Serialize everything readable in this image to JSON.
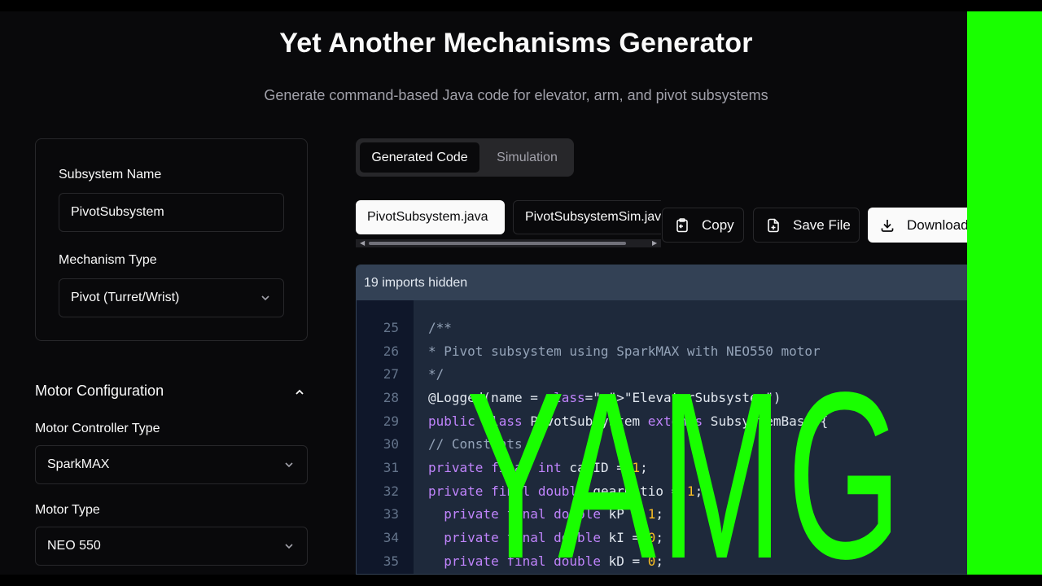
{
  "header": {
    "title": "Yet Another Mechanisms Generator",
    "subtitle": "Generate command-based Java code for elevator, arm, and pivot subsystems"
  },
  "config": {
    "subsystem_name_label": "Subsystem Name",
    "subsystem_name_value": "PivotSubsystem",
    "mechanism_type_label": "Mechanism Type",
    "mechanism_type_value": "Pivot (Turret/Wrist)"
  },
  "motor": {
    "section_title": "Motor Configuration",
    "controller_label": "Motor Controller Type",
    "controller_value": "SparkMAX",
    "motor_type_label": "Motor Type",
    "motor_type_value": "NEO 550"
  },
  "view_tabs": {
    "generated_code": "Generated Code",
    "simulation": "Simulation"
  },
  "file_tabs": {
    "active": "PivotSubsystem.java",
    "inactive": "PivotSubsystemSim.java"
  },
  "actions": {
    "copy": "Copy",
    "save_file": "Save File",
    "download": "Download"
  },
  "code": {
    "imports_hidden": "19 imports hidden",
    "lines": [
      {
        "n": "25",
        "text": "/**"
      },
      {
        "n": "26",
        "text": "* Pivot subsystem using SparkMAX with NEO550 motor"
      },
      {
        "n": "27",
        "text": "*/"
      },
      {
        "n": "28",
        "text": "@Logged(name = \"ElevatorSubsystem\")"
      },
      {
        "n": "29",
        "text": "public class PivotSubsystem extends SubsystemBase {"
      },
      {
        "n": "30",
        "text": "// Constants"
      },
      {
        "n": "31",
        "text": "private final int canID = 1;"
      },
      {
        "n": "32",
        "text": "private final double gearRatio = 1;"
      },
      {
        "n": "33",
        "text": "  private final double kP = 1;"
      },
      {
        "n": "34",
        "text": "  private final double kI = 0;"
      },
      {
        "n": "35",
        "text": "  private final double kD = 0;"
      }
    ]
  },
  "overlay": {
    "text": "YAMG",
    "color": "#19ff00"
  },
  "colors": {
    "background": "#09090b",
    "border": "#27272a",
    "green_screen": "#19ff00"
  }
}
